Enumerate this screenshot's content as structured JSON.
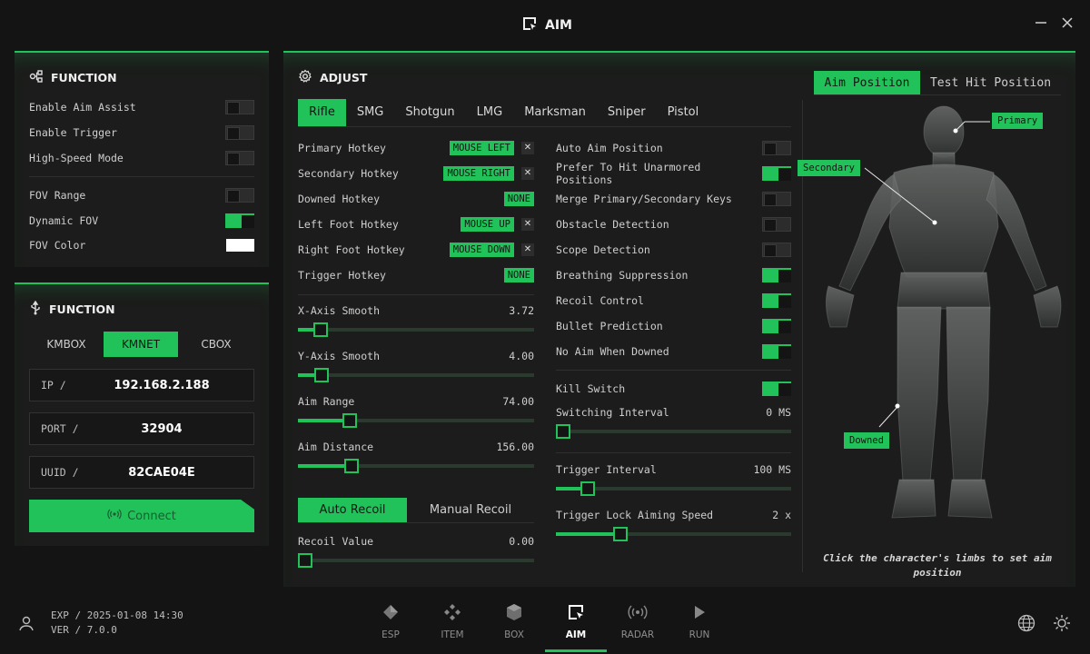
{
  "window": {
    "title": "AIM"
  },
  "function_panel": {
    "title": "FUNCTION",
    "toggles": [
      {
        "label": "Enable Aim Assist",
        "on": false
      },
      {
        "label": "Enable Trigger",
        "on": false
      },
      {
        "label": "High-Speed Mode",
        "on": false
      }
    ],
    "toggles2": [
      {
        "label": "FOV Range",
        "on": false
      },
      {
        "label": "Dynamic FOV",
        "on": true
      }
    ],
    "fov_color": {
      "label": "FOV Color",
      "value": "#ffffff"
    }
  },
  "device_panel": {
    "title": "FUNCTION",
    "modes": [
      "KMBOX",
      "KMNET",
      "CBOX"
    ],
    "active_mode": "KMNET",
    "ip": {
      "label": "IP /",
      "value": "192.168.2.188"
    },
    "port": {
      "label": "PORT /",
      "value": "32904"
    },
    "uuid": {
      "label": "UUID /",
      "value": "82CAE04E"
    },
    "connect_label": "Connect"
  },
  "adjust": {
    "title": "ADJUST",
    "weapon_tabs": [
      "Rifle",
      "SMG",
      "Shotgun",
      "LMG",
      "Marksman",
      "Sniper",
      "Pistol"
    ],
    "active_weapon": "Rifle",
    "hotkeys": [
      {
        "label": "Primary Hotkey",
        "key": "MOUSE LEFT",
        "clearable": true
      },
      {
        "label": "Secondary Hotkey",
        "key": "MOUSE RIGHT",
        "clearable": true
      },
      {
        "label": "Downed Hotkey",
        "key": "NONE",
        "clearable": false
      },
      {
        "label": "Left Foot Hotkey",
        "key": "MOUSE UP",
        "clearable": true
      },
      {
        "label": "Right Foot Hotkey",
        "key": "MOUSE DOWN",
        "clearable": true
      },
      {
        "label": "Trigger Hotkey",
        "key": "NONE",
        "clearable": false
      }
    ],
    "sliders": [
      {
        "label": "X-Axis Smooth",
        "value": "3.72",
        "fraction": 0.07
      },
      {
        "label": "Y-Axis Smooth",
        "value": "4.00",
        "fraction": 0.075
      },
      {
        "label": "Aim Range",
        "value": "74.00",
        "fraction": 0.2
      },
      {
        "label": "Aim Distance",
        "value": "156.00",
        "fraction": 0.21
      }
    ],
    "recoil_tabs": [
      "Auto Recoil",
      "Manual Recoil"
    ],
    "active_recoil": "Auto Recoil",
    "recoil_value": {
      "label": "Recoil Value",
      "value": "0.00",
      "fraction": 0
    },
    "options": [
      {
        "label": "Auto Aim Position",
        "on": false
      },
      {
        "label": "Prefer To Hit Unarmored Positions",
        "on": true
      },
      {
        "label": "Merge Primary/Secondary Keys",
        "on": false
      },
      {
        "label": "Obstacle Detection",
        "on": false
      },
      {
        "label": "Scope Detection",
        "on": false
      },
      {
        "label": "Breathing Suppression",
        "on": true
      },
      {
        "label": "Recoil Control",
        "on": true
      },
      {
        "label": "Bullet Prediction",
        "on": true
      },
      {
        "label": "No Aim When Downed",
        "on": true
      }
    ],
    "kill_switch": {
      "label": "Kill Switch",
      "on": true
    },
    "switching_interval": {
      "label": "Switching Interval",
      "value": "0 MS",
      "fraction": 0
    },
    "trigger_interval": {
      "label": "Trigger Interval",
      "value": "100 MS",
      "fraction": 0.11
    },
    "trigger_lock": {
      "label": "Trigger Lock Aiming Speed",
      "value": "2 x",
      "fraction": 0.26
    }
  },
  "position_panel": {
    "tabs": [
      "Aim Position",
      "Test Hit Position"
    ],
    "active_tab": "Aim Position",
    "callouts": {
      "primary": "Primary",
      "secondary": "Secondary",
      "downed": "Downed"
    },
    "hint": "Click the character's limbs to set aim position"
  },
  "footer": {
    "exp": "EXP / 2025-01-08 14:30",
    "ver": "VER / 7.0.0",
    "nav": [
      {
        "label": "ESP",
        "icon": "esp-icon"
      },
      {
        "label": "ITEM",
        "icon": "item-icon"
      },
      {
        "label": "BOX",
        "icon": "box-icon"
      },
      {
        "label": "AIM",
        "icon": "aim-icon"
      },
      {
        "label": "RADAR",
        "icon": "radar-icon"
      },
      {
        "label": "RUN",
        "icon": "run-icon"
      }
    ],
    "active_nav": "AIM"
  },
  "colors": {
    "accent": "#22c25a",
    "background": "#131413",
    "panel": "#1b1c1b"
  }
}
